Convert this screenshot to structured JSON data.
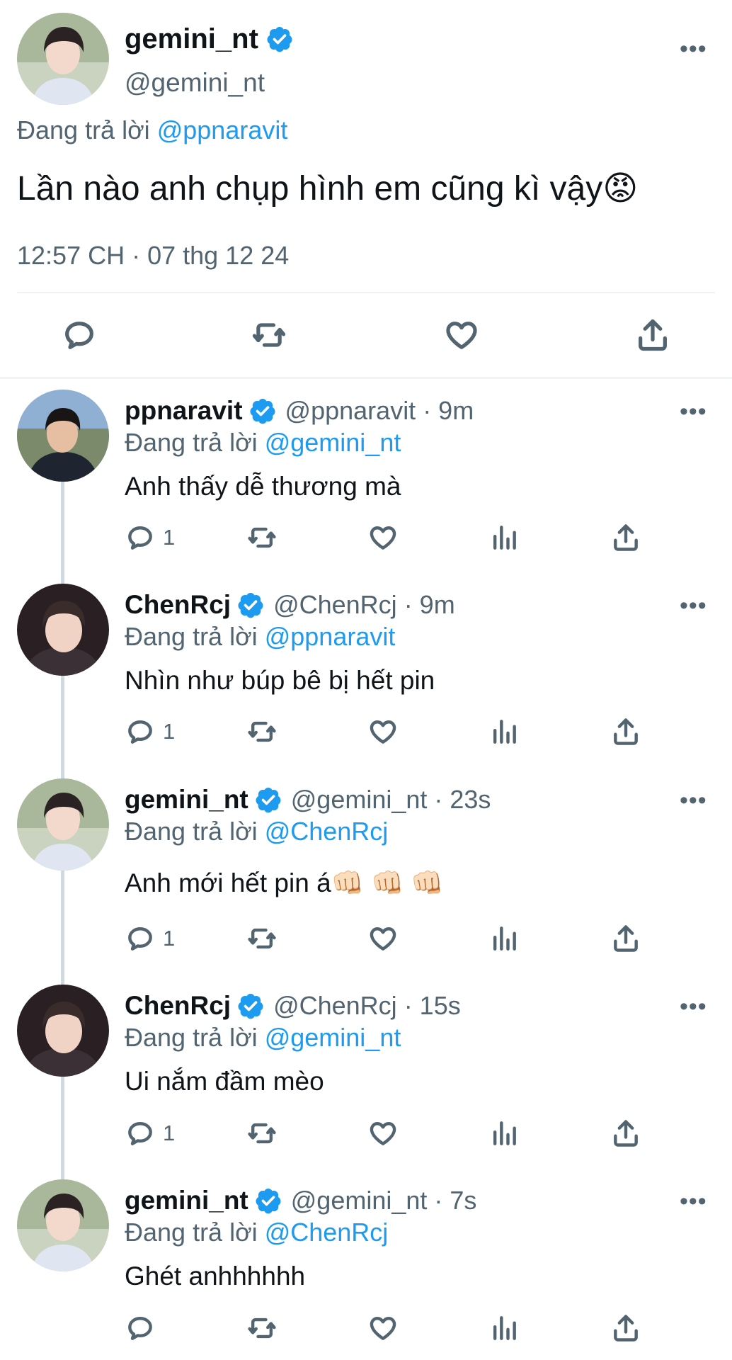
{
  "main": {
    "display_name": "gemini_nt",
    "handle": "@gemini_nt",
    "replying_label": "Đang trả lời",
    "replying_to": "@ppnaravit",
    "text": "Lần nào anh chụp hình em cũng kì vậy",
    "emoji": "😡",
    "timestamp": "12:57 CH · 07 thg 12 24",
    "more": "•••"
  },
  "replies": [
    {
      "name": "ppnaravit",
      "handle": "@ppnaravit",
      "time": "· 9m",
      "replying_label": "Đang trả lời",
      "replying_to": "@gemini_nt",
      "text": "Anh thấy dễ thương mà",
      "reply_count": "1",
      "more": "•••"
    },
    {
      "name": "ChenRcj",
      "handle": "@ChenRcj",
      "time": "· 9m",
      "replying_label": "Đang trả lời",
      "replying_to": "@ppnaravit",
      "text": "Nhìn như búp bê bị hết pin",
      "reply_count": "1",
      "more": "•••"
    },
    {
      "name": "gemini_nt",
      "handle": "@gemini_nt",
      "time": "· 23s",
      "replying_label": "Đang trả lời",
      "replying_to": "@ChenRcj",
      "text": "Anh mới hết pin á",
      "emoji": "👊🏻 👊🏻 👊🏻",
      "reply_count": "1",
      "more": "•••"
    },
    {
      "name": "ChenRcj",
      "handle": "@ChenRcj",
      "time": "· 15s",
      "replying_label": "Đang trả lời",
      "replying_to": "@gemini_nt",
      "text": "Ui nắm đầm mèo",
      "reply_count": "1",
      "more": "•••"
    },
    {
      "name": "gemini_nt",
      "handle": "@gemini_nt",
      "time": "· 7s",
      "replying_label": "Đang trả lời",
      "replying_to": "@ChenRcj",
      "text": "Ghét anhhhhhh",
      "reply_count": "",
      "more": "•••"
    }
  ],
  "colors": {
    "accent": "#1d9bf0",
    "secondary_text": "#536471",
    "divider": "#eff3f4",
    "thread_line": "#cfd9de"
  }
}
